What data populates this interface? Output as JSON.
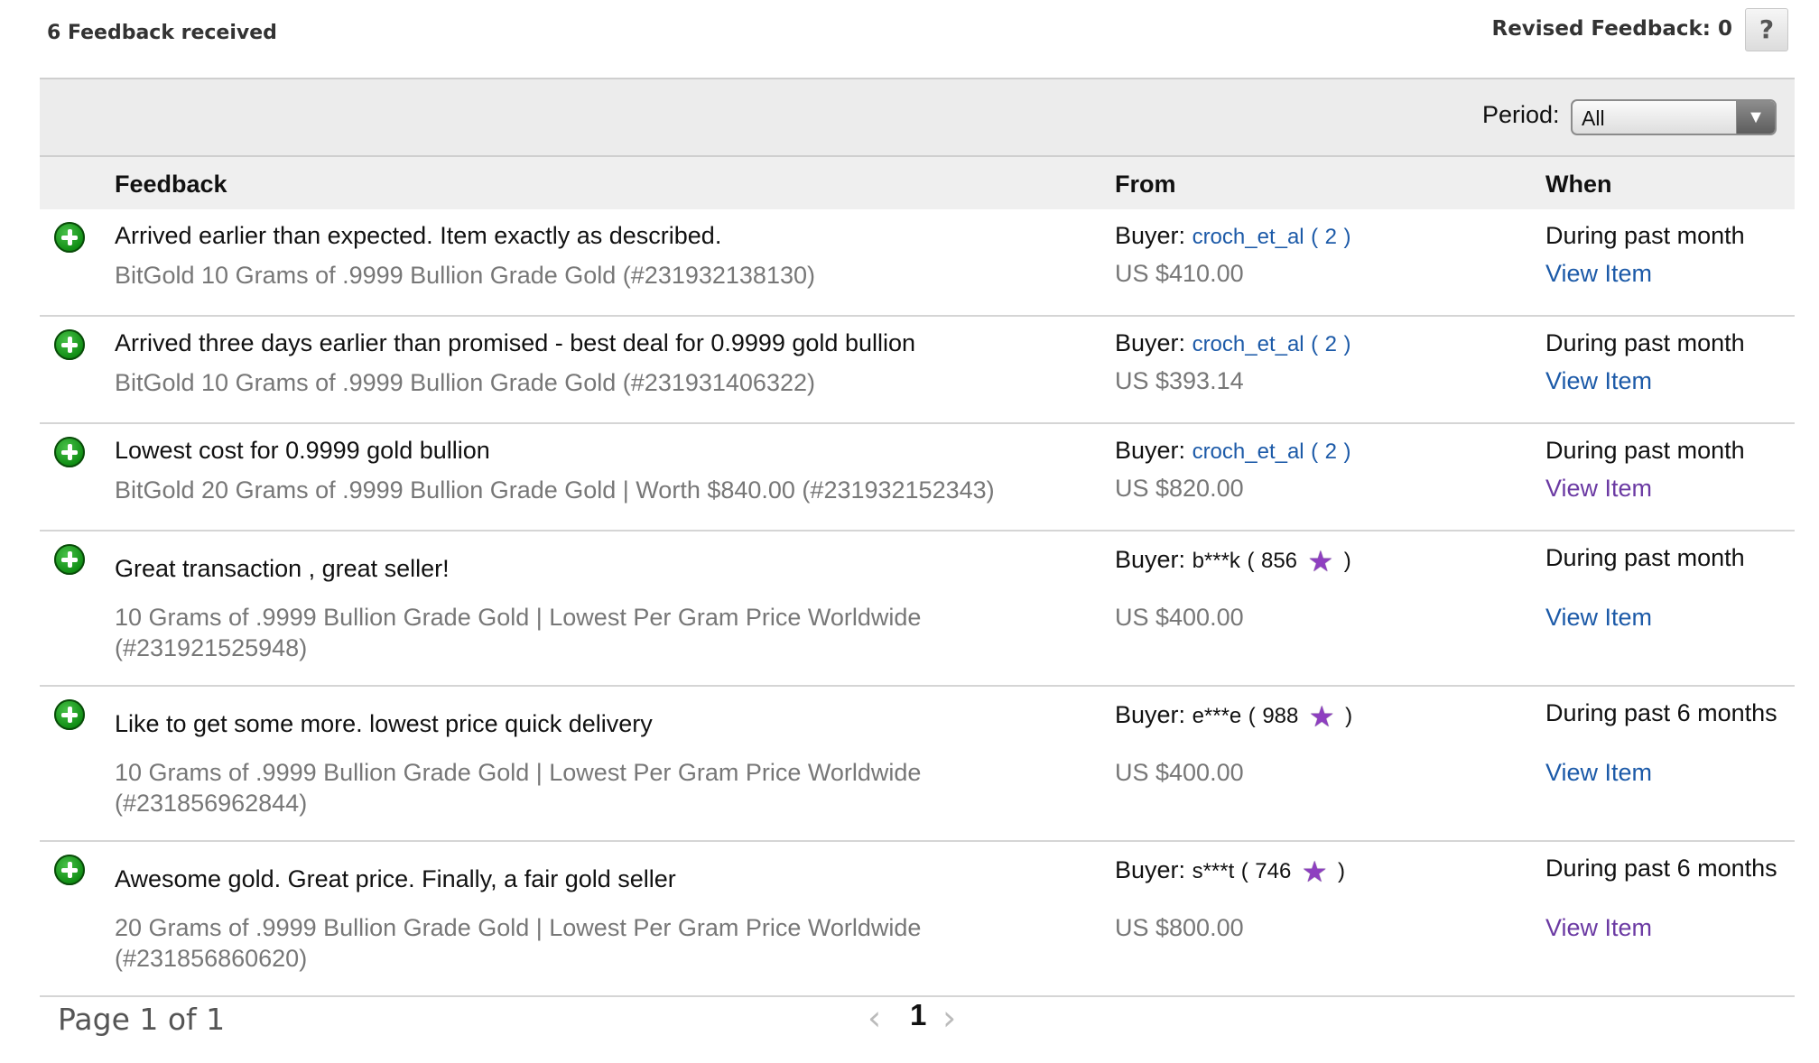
{
  "summary": {
    "received": "6 Feedback received",
    "revised": "Revised Feedback: 0",
    "help": "?"
  },
  "period": {
    "label": "Period:",
    "selected": "All"
  },
  "columns": {
    "feedback": "Feedback",
    "from": "From",
    "when": "When"
  },
  "rows": [
    {
      "comment": "Arrived earlier than expected. Item exactly as described.",
      "item": "BitGold 10 Grams of .9999 Bullion Grade Gold (#231932138130)",
      "buyer_prefix": "Buyer:",
      "buyer": "croch_et_al",
      "open": "(",
      "score": "2",
      "close": ")",
      "price": "US $410.00",
      "when": "During past month",
      "view": "View Item"
    },
    {
      "comment": "Arrived three days earlier than promised - best deal for 0.9999 gold bullion",
      "item": "BitGold 10 Grams of .9999 Bullion Grade Gold (#231931406322)",
      "buyer_prefix": "Buyer:",
      "buyer": "croch_et_al",
      "open": "(",
      "score": "2",
      "close": ")",
      "price": "US $393.14",
      "when": "During past month",
      "view": "View Item"
    },
    {
      "comment": "Lowest cost for 0.9999 gold bullion",
      "item": "BitGold 20 Grams of .9999 Bullion Grade Gold | Worth $840.00 (#231932152343)",
      "buyer_prefix": "Buyer:",
      "buyer": "croch_et_al",
      "open": "(",
      "score": "2",
      "close": ")",
      "price": "US $820.00",
      "when": "During past month",
      "view": "View Item"
    },
    {
      "comment": "Great transaction , great seller!",
      "item": "10 Grams of .9999 Bullion Grade Gold | Lowest Per Gram Price Worldwide (#231921525948)",
      "buyer_prefix": "Buyer:",
      "buyer": "b***k",
      "open": "(",
      "score": "856",
      "close": ")",
      "star": "purple-star-icon",
      "price": "US $400.00",
      "when": "During past month",
      "view": "View Item"
    },
    {
      "comment": "Like to get some more. lowest price quick delivery",
      "item": "10 Grams of .9999 Bullion Grade Gold | Lowest Per Gram Price Worldwide (#231856962844)",
      "buyer_prefix": "Buyer:",
      "buyer": "e***e",
      "open": "(",
      "score": "988",
      "close": ")",
      "star": "purple-star-icon",
      "price": "US $400.00",
      "when": "During past 6 months",
      "view": "View Item"
    },
    {
      "comment": "Awesome gold. Great price. Finally, a fair gold seller",
      "item": "20 Grams of .9999 Bullion Grade Gold | Lowest Per Gram Price Worldwide (#231856860620)",
      "buyer_prefix": "Buyer:",
      "buyer": "s***t",
      "open": "(",
      "score": "746",
      "close": ")",
      "star": "purple-star-icon",
      "price": "US $800.00",
      "when": "During past 6 months",
      "view": "View Item"
    }
  ],
  "pager": {
    "text": "Page 1 of 1",
    "current": "1",
    "prev": "‹",
    "next": "›"
  },
  "colors": {
    "link": "#1c5aa8",
    "visited_link": "#6b3aa3",
    "positive": "#0c8a10",
    "star": "#8e3fc0"
  }
}
